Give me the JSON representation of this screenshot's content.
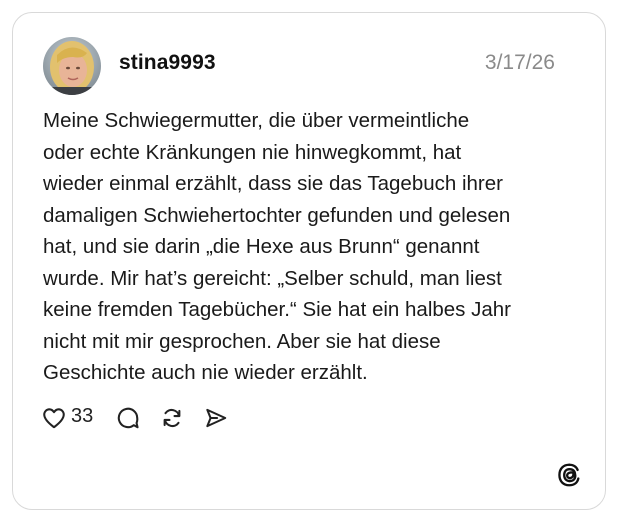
{
  "post": {
    "username": "stina9993",
    "date": "3/17/26",
    "text_lines": [
      "Meine Schwiegermutter, die über vermeintliche",
      "oder echte Kränkungen nie hinwegkommt, hat",
      "wieder einmal erzählt, dass sie das Tagebuch ihrer",
      "damaligen Schwiehertochter gefunden und gelesen",
      "hat, und sie darin „die Hexe aus Brunn“ genannt",
      "wurde. Mir hat’s gereicht: „Selber schuld, man liest",
      "keine fremden Tagebücher.“ Sie hat ein halbes Jahr",
      "nicht mit mir gesprochen. Aber sie hat diese",
      "Geschichte auch nie wieder erzählt."
    ],
    "likes": "33"
  },
  "icons": {
    "like": "heart-icon",
    "reply": "comment-bubble-icon",
    "repost": "repost-icon",
    "share": "send-icon",
    "brand": "threads-logo-icon"
  },
  "colors": {
    "text": "#1a1a1a",
    "muted": "#8a8a8a",
    "border": "#d9d9d9"
  }
}
